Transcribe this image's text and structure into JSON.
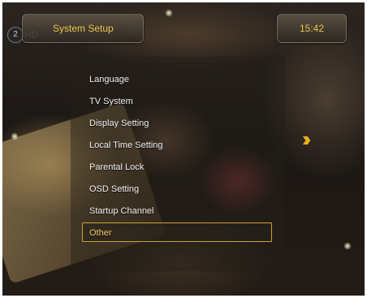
{
  "header": {
    "title": "System Setup",
    "mode_number": "2",
    "mode_label": "HD",
    "clock": "15:42"
  },
  "menu": {
    "items": [
      {
        "label": "Language"
      },
      {
        "label": "TV System"
      },
      {
        "label": "Display Setting"
      },
      {
        "label": "Local Time Setting"
      },
      {
        "label": "Parental Lock"
      },
      {
        "label": "OSD Setting"
      },
      {
        "label": "Startup Channel"
      },
      {
        "label": "Other"
      }
    ],
    "selected_index": 7
  },
  "icons": {
    "scroll_right": "double-chevron-right-icon"
  },
  "colors": {
    "accent_text": "#e8c54a",
    "selection_border": "#c9a42a",
    "menu_text": "#f2f2f2"
  }
}
